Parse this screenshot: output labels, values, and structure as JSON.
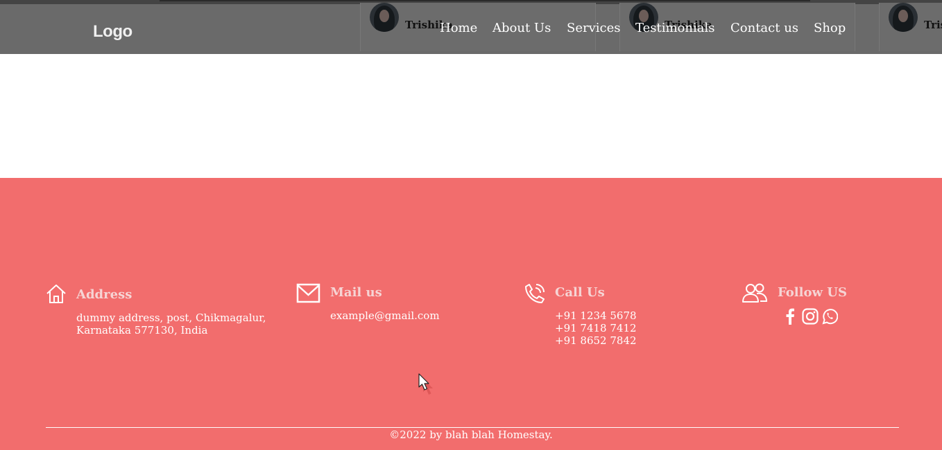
{
  "header": {
    "logo": "Logo",
    "nav": [
      "Home",
      "About Us",
      "Services",
      "Testimonials",
      "Contact us",
      "Shop"
    ],
    "testimonial_cards": [
      {
        "name": "Trishika"
      },
      {
        "name": "Trishika"
      },
      {
        "name": "Tris"
      }
    ]
  },
  "footer": {
    "address": {
      "title": "Address",
      "line1": "dummy address, post, Chikmagalur,",
      "line2": "Karnataka 577130, India",
      "icon": "home-icon"
    },
    "mail": {
      "title": "Mail us",
      "email": "example@gmail.com",
      "icon": "mail-icon"
    },
    "call": {
      "title": "Call Us",
      "phones": [
        "+91 1234 5678",
        "+91 7418 7412",
        "+91 8652 7842"
      ],
      "icon": "phone-icon"
    },
    "follow": {
      "title": "Follow US",
      "icon": "users-icon",
      "social_icons": [
        "facebook-icon",
        "instagram-icon",
        "whatsapp-icon"
      ]
    },
    "copyright": "©2022 by blah blah Homestay."
  },
  "colors": {
    "header_bg": "#6a6a6a",
    "footer_bg": "#f26d6d",
    "title_text": "#f6d4d4",
    "text": "#ffffff"
  }
}
